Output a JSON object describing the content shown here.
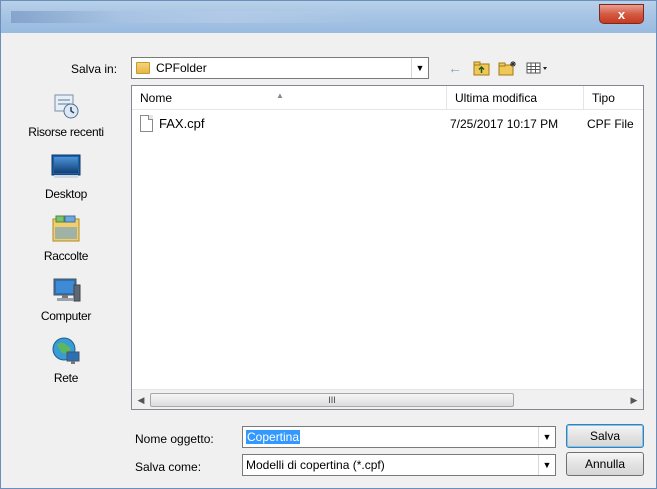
{
  "window": {
    "close_label": "x"
  },
  "location": {
    "label": "Salva in:",
    "folder": "CPFolder"
  },
  "toolbar": {
    "back_icon": "back-arrow-icon",
    "up_icon": "up-folder-icon",
    "new_folder_icon": "new-folder-icon",
    "views_icon": "views-menu-icon"
  },
  "places": [
    {
      "label": "Risorse recenti",
      "icon": "recent-places-icon"
    },
    {
      "label": "Desktop",
      "icon": "desktop-icon"
    },
    {
      "label": "Raccolte",
      "icon": "libraries-icon"
    },
    {
      "label": "Computer",
      "icon": "computer-icon"
    },
    {
      "label": "Rete",
      "icon": "network-icon"
    }
  ],
  "columns": {
    "name": "Nome",
    "modified": "Ultima modifica",
    "type": "Tipo"
  },
  "files": [
    {
      "name": "FAX.cpf",
      "modified": "7/25/2017 10:17 PM",
      "type": "CPF File"
    }
  ],
  "scroll": {
    "grip": "III"
  },
  "filename": {
    "label": "Nome oggetto:",
    "value": "Copertina"
  },
  "filetype": {
    "label": "Salva come:",
    "value": "Modelli di copertina (*.cpf)"
  },
  "buttons": {
    "save": "Salva",
    "cancel": "Annulla"
  },
  "colors": {
    "accent": "#3399ff",
    "close": "#c73a20"
  }
}
